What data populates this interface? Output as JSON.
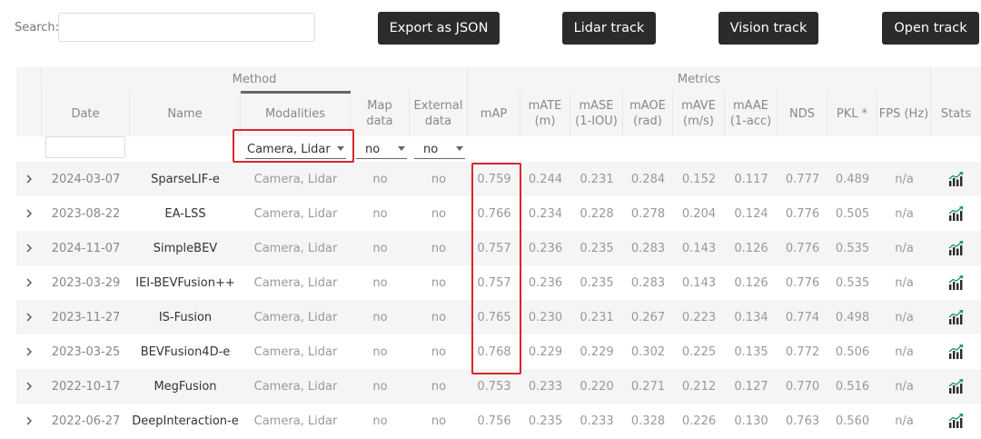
{
  "search": {
    "label": "Search:",
    "value": "",
    "placeholder": ""
  },
  "buttons": {
    "export": "Export as JSON",
    "lidar": "Lidar track",
    "vision": "Vision track",
    "open": "Open track"
  },
  "groups": {
    "method": "Method",
    "metrics": "Metrics"
  },
  "headers": {
    "date": "Date",
    "name": "Name",
    "modalities": "Modalities",
    "map_data": "Map\ndata",
    "external_data": "External\ndata",
    "map": "mAP",
    "mate": "mATE\n(m)",
    "mase": "mASE\n(1-IOU)",
    "maoe": "mAOE\n(rad)",
    "mave": "mAVE\n(m/s)",
    "maae": "mAAE\n(1-acc)",
    "nds": "NDS",
    "pkl": "PKL *",
    "fps": "FPS (Hz)",
    "stats": "Stats"
  },
  "filters": {
    "date_value": "",
    "modalities": "Camera, Lidar",
    "map_data": "no",
    "external_data": "no"
  },
  "icons": {
    "expand": "chevron-right-icon",
    "stats": "bar-chart-trend-icon"
  },
  "colors": {
    "button_bg": "#2b2b2b",
    "highlight": "#d9262b",
    "stats_icon": "#2a2a2a",
    "stats_arrow": "#1a9a6a"
  },
  "rows": [
    {
      "date": "2024-03-07",
      "name": "SparseLIF-e",
      "modalities": "Camera, Lidar",
      "map_data": "no",
      "external_data": "no",
      "map": "0.759",
      "mate": "0.244",
      "mase": "0.231",
      "maoe": "0.284",
      "mave": "0.152",
      "maae": "0.117",
      "nds": "0.777",
      "pkl": "0.489",
      "fps": "n/a"
    },
    {
      "date": "2023-08-22",
      "name": "EA-LSS",
      "modalities": "Camera, Lidar",
      "map_data": "no",
      "external_data": "no",
      "map": "0.766",
      "mate": "0.234",
      "mase": "0.228",
      "maoe": "0.278",
      "mave": "0.204",
      "maae": "0.124",
      "nds": "0.776",
      "pkl": "0.505",
      "fps": "n/a"
    },
    {
      "date": "2024-11-07",
      "name": "SimpleBEV",
      "modalities": "Camera, Lidar",
      "map_data": "no",
      "external_data": "no",
      "map": "0.757",
      "mate": "0.236",
      "mase": "0.235",
      "maoe": "0.283",
      "mave": "0.143",
      "maae": "0.126",
      "nds": "0.776",
      "pkl": "0.535",
      "fps": "n/a"
    },
    {
      "date": "2023-03-29",
      "name": "IEI-BEVFusion++",
      "modalities": "Camera, Lidar",
      "map_data": "no",
      "external_data": "no",
      "map": "0.757",
      "mate": "0.236",
      "mase": "0.235",
      "maoe": "0.283",
      "mave": "0.143",
      "maae": "0.126",
      "nds": "0.776",
      "pkl": "0.535",
      "fps": "n/a"
    },
    {
      "date": "2023-11-27",
      "name": "IS-Fusion",
      "modalities": "Camera, Lidar",
      "map_data": "no",
      "external_data": "no",
      "map": "0.765",
      "mate": "0.230",
      "mase": "0.231",
      "maoe": "0.267",
      "mave": "0.223",
      "maae": "0.134",
      "nds": "0.774",
      "pkl": "0.498",
      "fps": "n/a"
    },
    {
      "date": "2023-03-25",
      "name": "BEVFusion4D-e",
      "modalities": "Camera, Lidar",
      "map_data": "no",
      "external_data": "no",
      "map": "0.768",
      "mate": "0.229",
      "mase": "0.229",
      "maoe": "0.302",
      "mave": "0.225",
      "maae": "0.135",
      "nds": "0.772",
      "pkl": "0.506",
      "fps": "n/a"
    },
    {
      "date": "2022-10-17",
      "name": "MegFusion",
      "modalities": "Camera, Lidar",
      "map_data": "no",
      "external_data": "no",
      "map": "0.753",
      "mate": "0.233",
      "mase": "0.220",
      "maoe": "0.271",
      "mave": "0.212",
      "maae": "0.127",
      "nds": "0.770",
      "pkl": "0.516",
      "fps": "n/a"
    },
    {
      "date": "2022-06-27",
      "name": "DeepInteraction-e",
      "modalities": "Camera, Lidar",
      "map_data": "no",
      "external_data": "no",
      "map": "0.756",
      "mate": "0.235",
      "mase": "0.233",
      "maoe": "0.328",
      "mave": "0.226",
      "maae": "0.130",
      "nds": "0.763",
      "pkl": "0.560",
      "fps": "n/a"
    }
  ]
}
